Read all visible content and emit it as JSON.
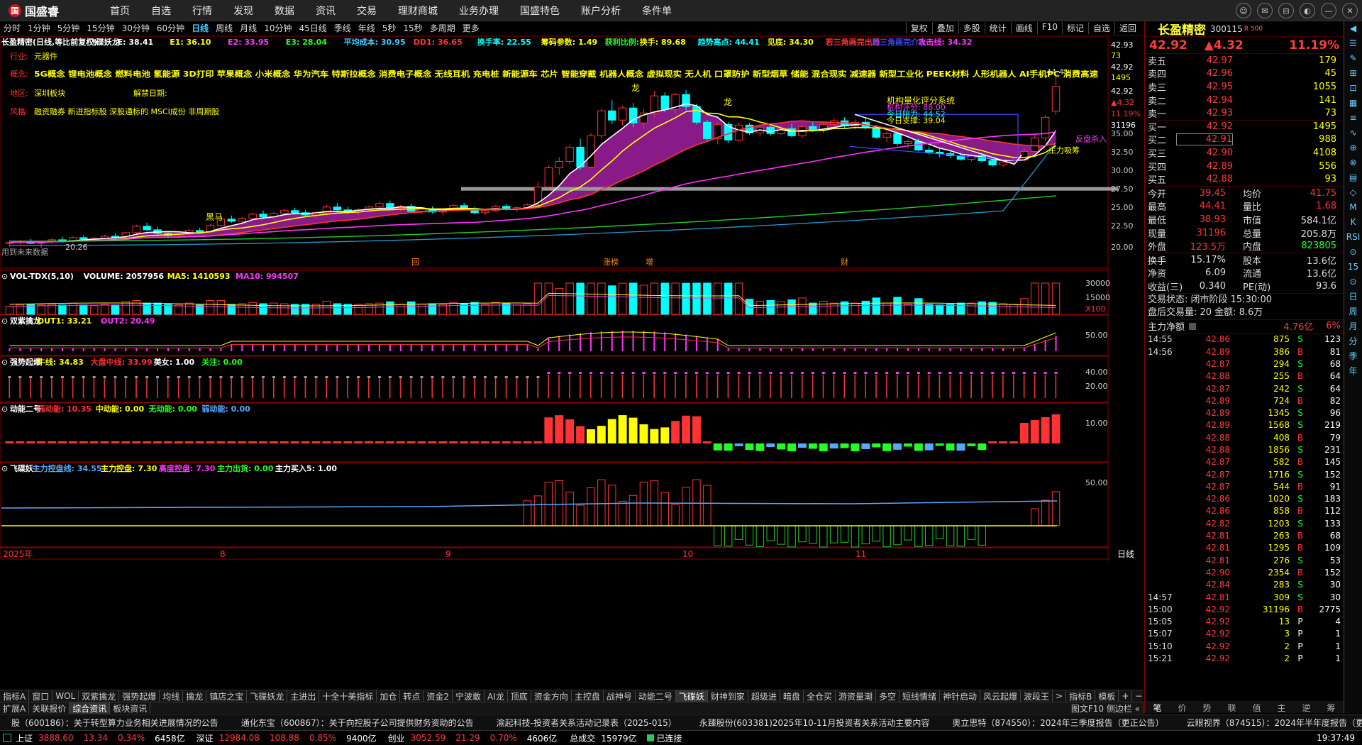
{
  "app": {
    "name": "国盛睿",
    "logo_text": "国"
  },
  "menu": [
    "首页",
    "自选",
    "行情",
    "发现",
    "数据",
    "资讯",
    "交易",
    "理财商城",
    "业务办理",
    "国盛特色",
    "账户分析",
    "条件单"
  ],
  "window_controls": [
    "☺",
    "✉",
    "⊟",
    "◐",
    "—",
    "✕"
  ],
  "periods": [
    "分时",
    "1分钟",
    "5分钟",
    "15分钟",
    "30分钟",
    "60分钟",
    "日线",
    "周线",
    "月线",
    "10分钟",
    "45日线",
    "季线",
    "年线",
    "5秒",
    "15秒",
    "多周期",
    "更多"
  ],
  "active_period": "日线",
  "toolbar_right": [
    "复权",
    "叠加",
    "多股",
    "统计",
    "画线",
    "F10",
    "标记",
    "自选",
    "返回"
  ],
  "main_legend": [
    {
      "t": "长盈精密(日线,等比前复权)",
      "c": "#fff"
    },
    {
      "t": "飞碟妖龙",
      "c": "#fff"
    },
    {
      "t": "E: 38.41",
      "c": "#fff"
    },
    {
      "t": "E1: 36.10",
      "c": "#ff0"
    },
    {
      "t": "E2: 33.95",
      "c": "#f3f"
    },
    {
      "t": "E3: 28.04",
      "c": "#2f2"
    },
    {
      "t": "平均成本: 30.95",
      "c": "#4cf"
    },
    {
      "t": "DD1: 36.65",
      "c": "#f33"
    },
    {
      "t": "换手率: 22.55",
      "c": "#0ff"
    },
    {
      "t": "筹码参数: 1.49",
      "c": "#ff0"
    },
    {
      "t": "获利比例:",
      "c": "#2f2"
    },
    {
      "t": "换手: 89.68",
      "c": "#ff0"
    },
    {
      "t": "趋势高点: 44.41",
      "c": "#0ff"
    },
    {
      "t": "见底: 34.30",
      "c": "#ff0"
    },
    {
      "t": "若三角画完出局",
      "c": "#f33"
    },
    {
      "t": "若三角画完介入",
      "c": "#44f"
    },
    {
      "t": "攻击线: 34.32",
      "c": "#f3f"
    }
  ],
  "info_lines": {
    "industry_label": "行业:",
    "industry": "元器件",
    "concept_label": "概念:",
    "concepts": "5G概念 锂电池概念 燃料电池 氢能源 3D打印 苹果概念 小米概念 华为汽车 特斯拉概念 消费电子概念 无线耳机 充电桩 新能源车 芯片 智能穿戴 机器人概念 虚拟现实 无人机 口罩防护 新型烟草 储能 混合现实 减速器 新型工业化 PEEK材料 人形机器人 AI手机PC 消费高速",
    "region_label": "地区:",
    "region": "深圳板块",
    "unban_label": "解禁日期:",
    "style_label": "风格:",
    "style": "融资融券 新进指标股 深股通标的 MSCI成份 非周期股"
  },
  "chart_text": {
    "scoring_title": "机构量化评分系统",
    "score": "机构评分: 88.00",
    "resistance": "今日阻力: 44.52",
    "support": "今日支撑: 39.04",
    "main_absorb": "主力吸筹",
    "fan_pan": "反盘杀入",
    "hi_label": "44.41",
    "lo_label": "20.26",
    "mark_labels": [
      "回",
      "涨榜",
      "增",
      "财"
    ],
    "date_labels": [
      "2025年",
      "8",
      "9",
      "10",
      "11"
    ],
    "low_note": "用到未来数据",
    "dragon": "龙",
    "heima": "黑马"
  },
  "y_axis": [
    "42.93",
    "73",
    "42.92",
    "1495",
    "42.92",
    "▲4.32",
    "11.19%",
    "31196",
    "35.00",
    "32.50",
    "30.00",
    "27.50",
    "25.00",
    "22.50",
    "20.00"
  ],
  "panels": [
    {
      "legend": [
        {
          "t": "VOL-TDX(5,10)",
          "c": "#fff"
        },
        {
          "t": "VOLUME: 2057956",
          "c": "#fff"
        },
        {
          "t": "MA5: 1410593",
          "c": "#ff0"
        },
        {
          "t": "MA10: 994507",
          "c": "#f3f"
        }
      ],
      "ticks": [
        "30000",
        "15000",
        "X100"
      ]
    },
    {
      "legend": [
        {
          "t": "双紫擒龙",
          "c": "#fff"
        },
        {
          "t": "OUT1: 33.21",
          "c": "#ff0"
        },
        {
          "t": "OUT2: 20.49",
          "c": "#f3f"
        }
      ],
      "ticks": [
        "50.00"
      ]
    },
    {
      "legend": [
        {
          "t": "强势起爆",
          "c": "#fff"
        },
        {
          "t": "牛线: 34.83",
          "c": "#ff0"
        },
        {
          "t": "大盘中线: 33.99",
          "c": "#f33"
        },
        {
          "t": "美女: 1.00",
          "c": "#fff"
        },
        {
          "t": "关注: 0.00",
          "c": "#2f2"
        }
      ],
      "ticks": [
        "40.00",
        "20.00"
      ]
    },
    {
      "legend": [
        {
          "t": "动能二号",
          "c": "#fff"
        },
        {
          "t": "强动能: 10.35",
          "c": "#f33"
        },
        {
          "t": "中动能: 0.00",
          "c": "#ff0"
        },
        {
          "t": "无动能: 0.00",
          "c": "#2f2"
        },
        {
          "t": "弱动能: 0.00",
          "c": "#5af"
        }
      ],
      "ticks": [
        "10.00"
      ]
    },
    {
      "legend": [
        {
          "t": "飞碟妖",
          "c": "#fff"
        },
        {
          "t": "主力控盘线: 34.55",
          "c": "#5af"
        },
        {
          "t": "主力控盘: 7.30",
          "c": "#ff0"
        },
        {
          "t": "高度控盘: 7.30",
          "c": "#f3f"
        },
        {
          "t": "主力出货: 0.00",
          "c": "#2f2"
        },
        {
          "t": "主力买入5: 1.00",
          "c": "#fff"
        }
      ],
      "ticks": [
        "50.00"
      ]
    }
  ],
  "bottom_period": "日线",
  "indicator_tabs": [
    "指标A",
    "窗口",
    "WOL",
    "双紫擒龙",
    "强势起爆",
    "均线",
    "擒龙",
    "镇店之宝",
    "飞碟妖龙",
    "主进出",
    "十全十美指标",
    "加仓",
    "转点",
    "资金2",
    "宁波敢",
    "AI龙",
    "顶底",
    "资金方向",
    "主控盘",
    "战神号",
    "动能二号",
    "飞碟妖",
    "财神到家",
    "超级进",
    "暗盘",
    "全仓买",
    "游资量潮",
    "多空",
    "短线情绪",
    "神针启动",
    "风云起爆",
    "波段王",
    ">",
    "指标B",
    "模板",
    "+",
    "−"
  ],
  "tabs2": [
    "扩展A",
    "关联报价",
    "综合资讯",
    "板块资讯"
  ],
  "tabs2_right": "图文F10 侧边栏 «",
  "stock": {
    "name": "长盈精密",
    "code": "300115",
    "sub": "R 500",
    "price": "42.92",
    "change": "▲4.32",
    "pct": "11.19%"
  },
  "orderbook": [
    {
      "l": "卖五",
      "p": "42.97",
      "v": "179"
    },
    {
      "l": "卖四",
      "p": "42.96",
      "v": "45"
    },
    {
      "l": "卖三",
      "p": "42.95",
      "v": "1055"
    },
    {
      "l": "卖二",
      "p": "42.94",
      "v": "141"
    },
    {
      "l": "卖一",
      "p": "42.93",
      "v": "73"
    },
    {
      "l": "买一",
      "p": "42.92",
      "v": "1495"
    },
    {
      "l": "买二",
      "p": "42.91",
      "v": "988"
    },
    {
      "l": "买三",
      "p": "42.90",
      "v": "4108"
    },
    {
      "l": "买四",
      "p": "42.89",
      "v": "556"
    },
    {
      "l": "买五",
      "p": "42.88",
      "v": "93"
    }
  ],
  "stats": [
    {
      "a": "今开",
      "av": "39.45",
      "ac": "#f33",
      "b": "均价",
      "bv": "41.75",
      "bc": "#f33"
    },
    {
      "a": "最高",
      "av": "44.41",
      "ac": "#f33",
      "b": "量比",
      "bv": "1.68",
      "bc": "#f33"
    },
    {
      "a": "最低",
      "av": "38.93",
      "ac": "#f33",
      "b": "市值",
      "bv": "584.1亿",
      "bc": "#ddd"
    },
    {
      "a": "现量",
      "av": "31196",
      "ac": "#f33",
      "b": "总量",
      "bv": "205.8万",
      "bc": "#ddd"
    },
    {
      "a": "外盘",
      "av": "123.5万",
      "ac": "#f33",
      "b": "内盘",
      "bv": "823805",
      "bc": "#2f2"
    }
  ],
  "stats2": [
    {
      "a": "换手",
      "av": "15.17%",
      "b": "股本",
      "bv": "13.6亿"
    },
    {
      "a": "净资",
      "av": "6.09",
      "b": "流通",
      "bv": "13.6亿"
    },
    {
      "a": "收益(三)",
      "av": "0.340",
      "b": "PE(动)",
      "bv": "93.6"
    }
  ],
  "trade_status": "交易状态: 闭市阶段 15:30:00",
  "after_hours": "盘后交易量: 20  金额: 8.6万",
  "main_net": {
    "label": "主力净额",
    "value": "4.76亿",
    "pct": "6%"
  },
  "ticks": [
    {
      "t": "14:55",
      "p": "42.86",
      "v": "875",
      "d": "S",
      "n": "123"
    },
    {
      "t": "14:56",
      "p": "42.89",
      "v": "386",
      "d": "B",
      "n": "81"
    },
    {
      "t": "",
      "p": "42.87",
      "v": "294",
      "d": "S",
      "n": "68"
    },
    {
      "t": "",
      "p": "42.88",
      "v": "255",
      "d": "B",
      "n": "64"
    },
    {
      "t": "",
      "p": "42.87",
      "v": "242",
      "d": "S",
      "n": "64"
    },
    {
      "t": "",
      "p": "42.89",
      "v": "724",
      "d": "B",
      "n": "82"
    },
    {
      "t": "",
      "p": "42.89",
      "v": "1345",
      "d": "S",
      "n": "96"
    },
    {
      "t": "",
      "p": "42.89",
      "v": "1568",
      "d": "S",
      "n": "219"
    },
    {
      "t": "",
      "p": "42.88",
      "v": "408",
      "d": "B",
      "n": "79"
    },
    {
      "t": "",
      "p": "42.88",
      "v": "1856",
      "d": "S",
      "n": "231"
    },
    {
      "t": "",
      "p": "42.87",
      "v": "582",
      "d": "B",
      "n": "145"
    },
    {
      "t": "",
      "p": "42.87",
      "v": "1716",
      "d": "S",
      "n": "152"
    },
    {
      "t": "",
      "p": "42.87",
      "v": "544",
      "d": "B",
      "n": "91"
    },
    {
      "t": "",
      "p": "42.86",
      "v": "1020",
      "d": "S",
      "n": "183"
    },
    {
      "t": "",
      "p": "42.86",
      "v": "858",
      "d": "B",
      "n": "112"
    },
    {
      "t": "",
      "p": "42.82",
      "v": "1203",
      "d": "S",
      "n": "133"
    },
    {
      "t": "",
      "p": "42.81",
      "v": "263",
      "d": "B",
      "n": "68"
    },
    {
      "t": "",
      "p": "42.81",
      "v": "1295",
      "d": "B",
      "n": "109"
    },
    {
      "t": "",
      "p": "42.81",
      "v": "276",
      "d": "S",
      "n": "53"
    },
    {
      "t": "",
      "p": "42.90",
      "v": "2354",
      "d": "B",
      "n": "152"
    },
    {
      "t": "",
      "p": "42.84",
      "v": "283",
      "d": "S",
      "n": "30"
    },
    {
      "t": "14:57",
      "p": "42.81",
      "v": "309",
      "d": "S",
      "n": "30"
    },
    {
      "t": "15:00",
      "p": "42.92",
      "v": "31196",
      "d": "B",
      "n": "2775"
    },
    {
      "t": "15:05",
      "p": "42.92",
      "v": "13",
      "d": "P",
      "n": "4"
    },
    {
      "t": "15:07",
      "p": "42.92",
      "v": "3",
      "d": "P",
      "n": "1"
    },
    {
      "t": "15:10",
      "p": "42.92",
      "v": "2",
      "d": "P",
      "n": "1"
    },
    {
      "t": "15:21",
      "p": "42.92",
      "v": "2",
      "d": "P",
      "n": "1"
    }
  ],
  "rp_tabs": [
    "笔",
    "价",
    "势",
    "联",
    "值",
    "主",
    "逆",
    "筹"
  ],
  "side_strip": [
    "◀",
    "☰",
    "✎",
    "⊞",
    "⊡",
    "▦",
    "≡",
    "∿",
    "⊕",
    "⊗",
    "▤",
    "◇",
    "M",
    "K",
    "RSI",
    "⊙",
    "15",
    "⊙",
    "日",
    "周",
    "月",
    "分",
    "季",
    "年"
  ],
  "news": [
    "股（600186）：关于转型算力业务相关进展情况的公告",
    "通化东宝（600867）：关于向控股子公司提供财务资助的公告",
    "渝起科技-投资者关系活动记录表（2025-015）",
    "永臻股份(603381)2025年10-11月投资者关系活动主要内容",
    "奥立思特（874550）：2024年三季度报告（更正公告）",
    "云眼视界（874515）：2024年半年度报告（更"
  ],
  "status": {
    "sh_label": "上证",
    "sh": "3888.60",
    "sh_chg": "13.34",
    "sh_pct": "0.34%",
    "sh_amt": "6458亿",
    "sz_label": "深证",
    "sz": "12984.08",
    "sz_chg": "108.88",
    "sz_pct": "0.85%",
    "sz_amt": "9400亿",
    "cy_label": "创业",
    "cy": "3052.59",
    "cy_chg": "21.29",
    "cy_pct": "0.70%",
    "cy_amt": "4606亿",
    "total_label": "总成交",
    "total": "15979亿",
    "conn": "已连接",
    "time": "19:37:49"
  },
  "chart_data": {
    "type": "candlestick",
    "title": "长盈精密(日线,等比前复权)",
    "x_labels": [
      "2025年",
      "8",
      "9",
      "10",
      "11"
    ],
    "ylim": [
      20,
      45
    ],
    "candles": [
      [
        21.0,
        21.3,
        20.4,
        21.0
      ],
      [
        21.0,
        21.4,
        20.7,
        21.2
      ],
      [
        21.2,
        21.5,
        20.8,
        20.9
      ],
      [
        20.9,
        21.3,
        20.26,
        21.1
      ],
      [
        21.1,
        21.6,
        20.9,
        21.4
      ],
      [
        21.4,
        21.8,
        21.0,
        21.2
      ],
      [
        21.2,
        21.9,
        21.0,
        21.7
      ],
      [
        21.7,
        22.0,
        21.2,
        21.5
      ],
      [
        21.5,
        21.8,
        21.1,
        21.6
      ],
      [
        21.6,
        22.1,
        21.4,
        21.9
      ],
      [
        21.9,
        22.3,
        21.5,
        21.7
      ],
      [
        21.7,
        22.5,
        21.6,
        22.4
      ],
      [
        22.4,
        23.5,
        22.2,
        23.3
      ],
      [
        23.3,
        23.8,
        22.6,
        22.8
      ],
      [
        22.8,
        23.2,
        22.0,
        22.3
      ],
      [
        22.3,
        22.6,
        21.8,
        22.0
      ],
      [
        22.0,
        22.4,
        21.6,
        22.2
      ],
      [
        22.2,
        22.9,
        22.0,
        22.7
      ],
      [
        22.7,
        23.1,
        22.3,
        22.5
      ],
      [
        22.5,
        23.6,
        22.4,
        23.4
      ],
      [
        23.4,
        24.5,
        23.2,
        24.3
      ],
      [
        24.3,
        24.8,
        23.8,
        24.0
      ],
      [
        24.0,
        24.6,
        23.6,
        24.4
      ],
      [
        24.4,
        25.2,
        24.2,
        25.0
      ],
      [
        25.0,
        25.5,
        24.3,
        24.6
      ],
      [
        24.6,
        25.3,
        24.2,
        25.1
      ],
      [
        25.1,
        25.8,
        24.8,
        25.5
      ],
      [
        25.5,
        25.9,
        24.9,
        25.2
      ],
      [
        25.2,
        25.6,
        24.7,
        24.9
      ],
      [
        24.9,
        25.4,
        24.4,
        25.2
      ],
      [
        25.2,
        26.3,
        25.0,
        26.0
      ],
      [
        26.0,
        26.6,
        25.4,
        25.6
      ],
      [
        25.6,
        26.0,
        25.0,
        25.3
      ],
      [
        25.3,
        25.8,
        24.9,
        25.6
      ],
      [
        25.6,
        26.2,
        25.4,
        26.0
      ],
      [
        26.0,
        26.8,
        25.8,
        26.5
      ],
      [
        26.5,
        26.9,
        25.6,
        25.8
      ],
      [
        25.8,
        26.3,
        25.4,
        26.1
      ],
      [
        26.1,
        26.5,
        25.2,
        25.4
      ],
      [
        25.4,
        25.9,
        25.0,
        25.7
      ],
      [
        25.7,
        26.1,
        25.1,
        25.3
      ],
      [
        25.3,
        25.8,
        24.8,
        25.6
      ],
      [
        25.6,
        26.4,
        25.4,
        26.2
      ],
      [
        26.2,
        26.6,
        25.6,
        25.8
      ],
      [
        25.8,
        26.0,
        25.0,
        25.2
      ],
      [
        25.2,
        25.7,
        24.9,
        25.5
      ],
      [
        25.5,
        26.3,
        25.3,
        26.1
      ],
      [
        26.1,
        26.4,
        25.5,
        25.7
      ],
      [
        25.7,
        26.1,
        25.3,
        25.9
      ],
      [
        25.9,
        26.5,
        25.7,
        26.3
      ],
      [
        26.3,
        29.5,
        26.2,
        28.8
      ],
      [
        28.8,
        31.8,
        28.6,
        31.5
      ],
      [
        31.5,
        33.0,
        30.5,
        32.4
      ],
      [
        32.4,
        34.8,
        32.0,
        34.4
      ],
      [
        34.4,
        35.6,
        31.2,
        31.6
      ],
      [
        31.6,
        36.4,
        31.4,
        36.0
      ],
      [
        36.0,
        39.8,
        35.6,
        39.5
      ],
      [
        39.5,
        41.0,
        37.6,
        38.2
      ],
      [
        38.2,
        40.2,
        37.4,
        39.9
      ],
      [
        39.9,
        40.6,
        37.2,
        37.8
      ],
      [
        37.8,
        39.8,
        37.0,
        39.2
      ],
      [
        39.2,
        42.3,
        38.6,
        41.6
      ],
      [
        41.6,
        42.1,
        39.3,
        39.7
      ],
      [
        39.7,
        42.0,
        39.0,
        41.8
      ],
      [
        41.8,
        42.4,
        39.6,
        40.1
      ],
      [
        40.1,
        40.5,
        37.6,
        37.9
      ],
      [
        37.9,
        38.2,
        35.3,
        35.6
      ],
      [
        35.6,
        38.0,
        34.8,
        37.6
      ],
      [
        37.6,
        37.9,
        35.0,
        35.4
      ],
      [
        35.4,
        37.8,
        35.2,
        37.5
      ],
      [
        37.5,
        37.8,
        36.1,
        36.4
      ],
      [
        36.4,
        37.6,
        35.9,
        37.2
      ],
      [
        37.2,
        37.5,
        36.0,
        36.3
      ],
      [
        36.3,
        37.4,
        36.1,
        37.0
      ],
      [
        37.0,
        37.7,
        35.8,
        36.0
      ],
      [
        36.0,
        37.5,
        35.7,
        37.3
      ],
      [
        37.3,
        38.0,
        36.6,
        36.8
      ],
      [
        36.8,
        37.9,
        36.4,
        37.6
      ],
      [
        37.6,
        38.5,
        37.2,
        38.1
      ],
      [
        38.1,
        38.6,
        37.1,
        37.4
      ],
      [
        37.4,
        38.3,
        36.9,
        37.9
      ],
      [
        37.9,
        38.4,
        36.9,
        37.1
      ],
      [
        37.1,
        37.5,
        35.6,
        35.8
      ],
      [
        35.8,
        36.6,
        35.1,
        36.3
      ],
      [
        36.3,
        36.6,
        34.6,
        34.9
      ],
      [
        34.9,
        35.5,
        34.2,
        35.2
      ],
      [
        35.2,
        35.6,
        33.8,
        34.0
      ],
      [
        34.0,
        34.5,
        33.4,
        33.7
      ],
      [
        33.7,
        34.2,
        33.0,
        33.5
      ],
      [
        33.5,
        33.9,
        32.9,
        33.2
      ],
      [
        33.2,
        33.6,
        32.5,
        32.7
      ],
      [
        32.7,
        33.4,
        32.4,
        33.2
      ],
      [
        33.2,
        33.5,
        32.3,
        32.5
      ],
      [
        32.5,
        32.9,
        31.7,
        31.9
      ],
      [
        31.9,
        32.6,
        31.6,
        32.3
      ],
      [
        32.3,
        32.9,
        32.0,
        32.6
      ],
      [
        32.6,
        34.2,
        32.4,
        33.8
      ],
      [
        33.8,
        36.2,
        33.6,
        35.7
      ],
      [
        35.7,
        38.9,
        35.2,
        38.6
      ],
      [
        39.45,
        44.41,
        38.93,
        42.92
      ]
    ]
  }
}
